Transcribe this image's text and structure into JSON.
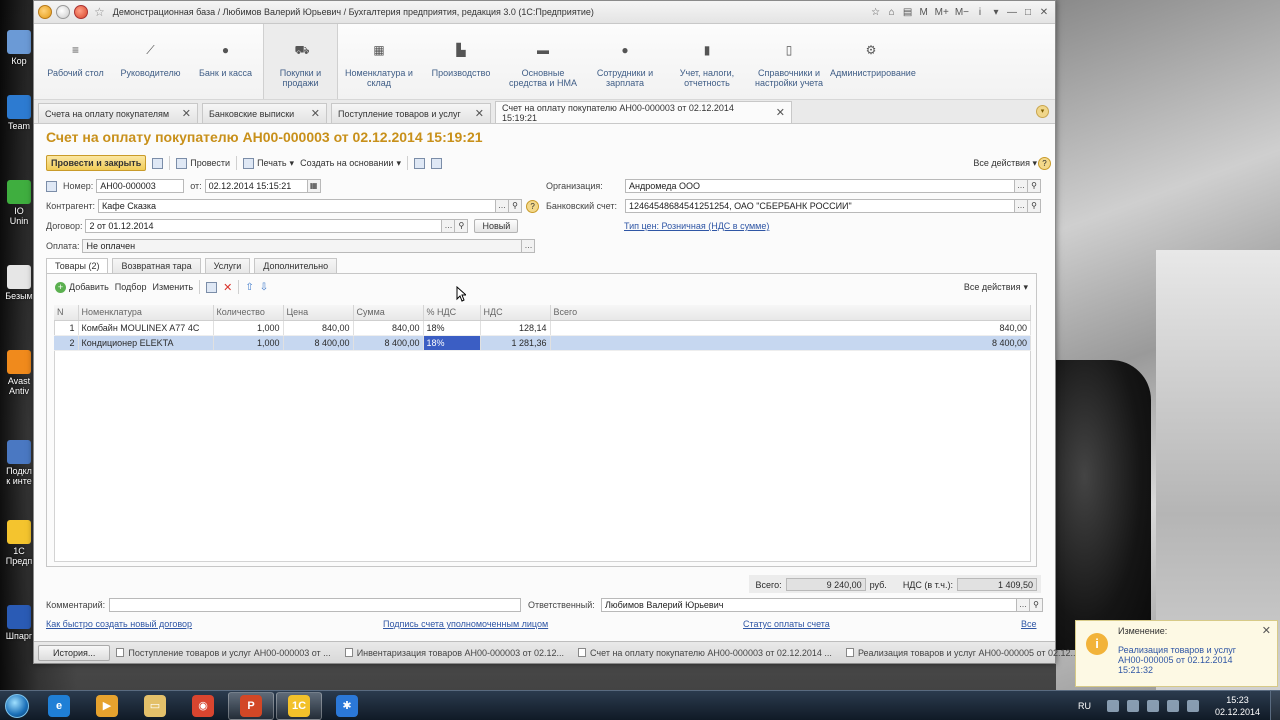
{
  "desktop": {
    "icons": [
      {
        "label": "Кор",
        "color": "#6b9ad6"
      },
      {
        "label": "Team",
        "color": "#2d7bd1"
      },
      {
        "label": "IO Unin",
        "color": "#3fae3f"
      },
      {
        "label": "Безым",
        "color": "#e6e6e6"
      },
      {
        "label": "Avast Antiv",
        "color": "#f08a1c"
      },
      {
        "label": "Подкл к инте",
        "color": "#4a78c2"
      },
      {
        "label": "1С Предп",
        "color": "#f4c42e"
      },
      {
        "label": "Шпарг",
        "color": "#2a5bb5"
      }
    ]
  },
  "window": {
    "title": "Демонстрационная база / Любимов Валерий Юрьевич / Бухгалтерия предприятия, редакция 3.0  (1С:Предприятие)",
    "tools": [
      "☆",
      "⌂",
      "▤",
      "M",
      "M+",
      "M−",
      "i",
      "▾",
      "—",
      "□",
      "✕"
    ]
  },
  "sections": [
    {
      "label": "Рабочий стол",
      "icon": "menu-icon",
      "glyph": "≡"
    },
    {
      "label": "Руководителю",
      "icon": "chart-line-icon",
      "glyph": "⟋"
    },
    {
      "label": "Банк и касса",
      "icon": "coin-icon",
      "glyph": "●"
    },
    {
      "label": "Покупки и продажи",
      "icon": "cart-icon",
      "glyph": "⛟"
    },
    {
      "label": "Номенклатура и склад",
      "icon": "grid-icon",
      "glyph": "▦"
    },
    {
      "label": "Производство",
      "icon": "factory-icon",
      "glyph": "▙"
    },
    {
      "label": "Основные средства и НМА",
      "icon": "truck-icon",
      "glyph": "▬"
    },
    {
      "label": "Сотрудники и зарплата",
      "icon": "person-icon",
      "glyph": "●"
    },
    {
      "label": "Учет, налоги, отчетность",
      "icon": "bar-chart-icon",
      "glyph": "▮"
    },
    {
      "label": "Справочники и настройки учета",
      "icon": "book-icon",
      "glyph": "▯"
    },
    {
      "label": "Администрирование",
      "icon": "gear-icon",
      "glyph": "⚙"
    }
  ],
  "open_tabs": [
    {
      "label": "Счета на оплату покупателям",
      "active": false
    },
    {
      "label": "Банковские выписки",
      "active": false
    },
    {
      "label": "Поступление товаров и услуг",
      "active": false
    },
    {
      "label": "Счет на оплату покупателю АН00-000003 от 02.12.2014 15:19:21",
      "active": true
    }
  ],
  "document": {
    "title": "Счет на оплату покупателю АН00-000003 от 02.12.2014 15:19:21",
    "toolbar": {
      "post_close": "Провести и закрыть",
      "post": "Провести",
      "print": "Печать",
      "create_based": "Создать на основании",
      "all_actions": "Все действия",
      "help": "?"
    },
    "fields": {
      "number_label": "Номер:",
      "number": "АН00-000003",
      "date_label": "от:",
      "date": "02.12.2014 15:15:21",
      "org_label": "Организация:",
      "org": "Андромеда ООО",
      "counterparty_label": "Контрагент:",
      "counterparty": "Кафе Сказка",
      "bank_label": "Банковский счет:",
      "bank": "12464548684541251254, ОАО \"СБЕРБАНК РОССИИ\"",
      "contract_label": "Договор:",
      "contract": "2 от 01.12.2014",
      "new_btn": "Новый",
      "price_type_link": "Тип цен: Розничная (НДС в сумме)",
      "payment_label": "Оплата:",
      "payment": "Не оплачен"
    },
    "tabs": [
      "Товары (2)",
      "Возвратная тара",
      "Услуги",
      "Дополнительно"
    ],
    "grid_toolbar": {
      "add": "Добавить",
      "pick": "Подбор",
      "edit": "Изменить",
      "all_actions": "Все действия"
    },
    "columns": [
      "N",
      "Номенклатура",
      "Количество",
      "Цена",
      "Сумма",
      "% НДС",
      "НДС",
      "Всего"
    ],
    "rows": [
      {
        "n": "1",
        "item": "Комбайн MOULINEX A77 4C",
        "qty": "1,000",
        "price": "840,00",
        "sum": "840,00",
        "vat_rate": "18%",
        "vat": "128,14",
        "total": "840,00"
      },
      {
        "n": "2",
        "item": "Кондиционер ELEKTA",
        "qty": "1,000",
        "price": "8 400,00",
        "sum": "8 400,00",
        "vat_rate": "18%",
        "vat": "1 281,36",
        "total": "8 400,00"
      }
    ],
    "totals": {
      "total_label": "Всего:",
      "total": "9 240,00",
      "currency": "руб.",
      "vat_label": "НДС (в т.ч.):",
      "vat": "1 409,50"
    },
    "footer": {
      "comment_label": "Комментарий:",
      "comment": "",
      "responsible_label": "Ответственный:",
      "responsible": "Любимов Валерий Юрьевич",
      "link1": "Как быстро создать новый договор",
      "link2": "Подпись счета уполномоченным лицом",
      "link3": "Статус оплаты счета",
      "link4": "Все"
    }
  },
  "window_bar": {
    "history": "История...",
    "items": [
      "Поступление товаров и услуг АН00-000003 от ...",
      "Инвентаризация товаров АН00-000003 от 02.12...",
      "Счет на оплату покупателю АН00-000003 от 02.12.2014 ...",
      "Реализация товаров и услуг АН00-000005 от 02.12..."
    ]
  },
  "notification": {
    "title": "Изменение:",
    "text": "Реализация товаров и услуг АН00-000005 от 02.12.2014 15:21:32"
  },
  "taskbar": {
    "apps": [
      {
        "name": "ie-icon",
        "glyph": "e",
        "color": "#1f7fd6",
        "active": false
      },
      {
        "name": "media-icon",
        "glyph": "▶",
        "color": "#e6a22e",
        "active": false
      },
      {
        "name": "folder-icon",
        "glyph": "▭",
        "color": "#e3c06a",
        "active": false
      },
      {
        "name": "chrome-icon",
        "glyph": "◉",
        "color": "#d9452f",
        "active": false
      },
      {
        "name": "powerpoint-icon",
        "glyph": "P",
        "color": "#d24726",
        "active": true
      },
      {
        "name": "1c-icon",
        "glyph": "1С",
        "color": "#f3c12a",
        "active": true
      },
      {
        "name": "snowflake-icon",
        "glyph": "✱",
        "color": "#2b78d8",
        "active": false
      }
    ],
    "lang": "RU",
    "time": "15:23",
    "date": "02.12.2014"
  }
}
